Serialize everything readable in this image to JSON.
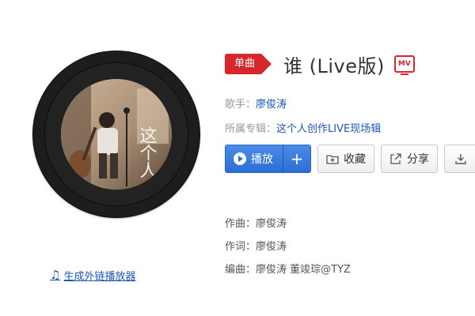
{
  "album": {
    "cover_text": "这个人",
    "external_player_label": "生成外链播放器",
    "external_player_icon": "music-note-icon"
  },
  "song": {
    "type_badge": "单曲",
    "title": "谁 (Live版)",
    "mv_label": "MV"
  },
  "meta": {
    "singer_label": "歌手：",
    "singer_value": "廖俊涛",
    "album_label": "所属专辑：",
    "album_value": "这个人创作LIVE现场辑"
  },
  "buttons": {
    "play_label": "播放",
    "add_label": "+",
    "collect_label": "收藏",
    "share_label": "分享"
  },
  "credits": {
    "composer_label": "作曲：",
    "composer_value": "廖俊涛",
    "lyricist_label": "作词：",
    "lyricist_value": "廖俊涛",
    "arranger_label": "编曲：",
    "arranger_value": "廖俊涛 董竣琮@TYZ"
  },
  "colors": {
    "accent_red": "#d8262d",
    "link_blue": "#1a56b8",
    "play_blue": "#2c6fd4"
  }
}
